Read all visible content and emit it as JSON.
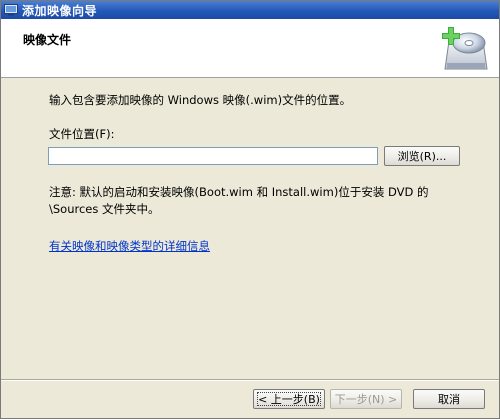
{
  "window": {
    "title": "添加映像向导",
    "icon": "wizard-window-icon"
  },
  "header": {
    "title": "映像文件",
    "graphic_icon": "disc-add-icon"
  },
  "main": {
    "description": "输入包含要添加映像的 Windows 映像(.wim)文件的位置。",
    "location_label": "文件位置(F):",
    "location_value": "",
    "browse_label": "浏览(R)...",
    "note": "注意: 默认的启动和安装映像(Boot.wim 和 Install.wim)位于安装 DVD 的 \\Sources 文件夹中。",
    "help_link": "有关映像和映像类型的详细信息"
  },
  "footer": {
    "back_label": "< 上一步(B)",
    "next_label": "下一步(N) >",
    "cancel_label": "取消"
  },
  "colors": {
    "titlebar": "#2458b8",
    "link": "#0033cc",
    "background": "#ece9d8"
  }
}
